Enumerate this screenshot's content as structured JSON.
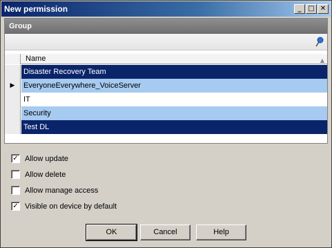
{
  "window": {
    "title": "New permission",
    "controls": {
      "minimize": "_",
      "maximize": "□",
      "close": "✕"
    }
  },
  "group": {
    "header": "Group",
    "pin_icon": "pin-icon",
    "column_name": "Name",
    "sort_glyph": "▲",
    "rows": [
      {
        "name": "Disaster Recovery Team",
        "style": "dark",
        "indicator": ""
      },
      {
        "name": "EveryoneEverywhere_VoiceServer",
        "style": "light",
        "indicator": "▶"
      },
      {
        "name": "IT",
        "style": "plain",
        "indicator": ""
      },
      {
        "name": "Security",
        "style": "light",
        "indicator": ""
      },
      {
        "name": "Test DL",
        "style": "dark",
        "indicator": ""
      }
    ]
  },
  "options": [
    {
      "label": "Allow update",
      "checked": true
    },
    {
      "label": "Allow delete",
      "checked": false
    },
    {
      "label": "Allow manage access",
      "checked": false
    },
    {
      "label": "Visible on device by default",
      "checked": true
    }
  ],
  "buttons": {
    "ok": "OK",
    "cancel": "Cancel",
    "help": "Help"
  },
  "colors": {
    "selection_dark": "#0a246a",
    "selection_light": "#a6caf0",
    "dialog_bg": "#d4d0c8"
  }
}
